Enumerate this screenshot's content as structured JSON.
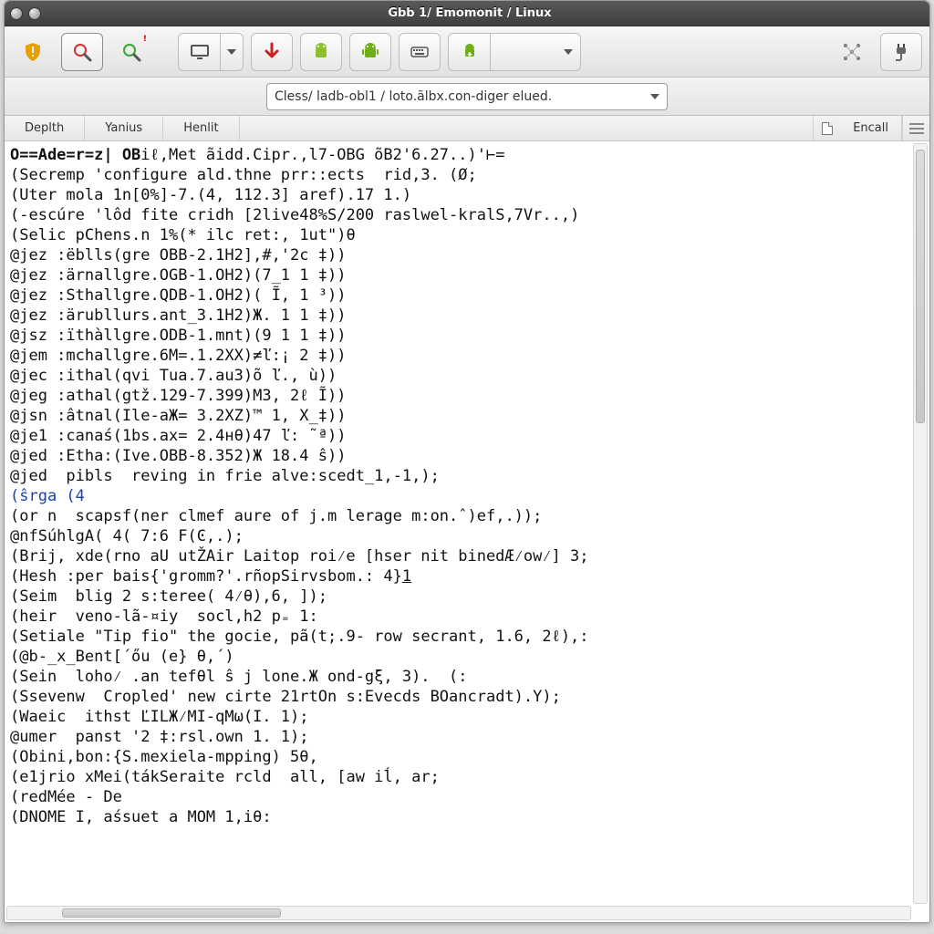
{
  "window": {
    "title": "Gbb 1/ Emomonit / Linux"
  },
  "combo": {
    "selected": "Cless/ ladb-obl1 / loto.ãlbx.con-diger elued."
  },
  "tabs": {
    "items": [
      {
        "label": "Deplth"
      },
      {
        "label": "Yanius"
      },
      {
        "label": "Henlit"
      }
    ],
    "right_label": "Encall"
  },
  "code": {
    "lines": [
      "O==Ade=r=z| OBiℓ,Met ãidd.Cipr.,l7-OBG õB2'6.27..)'⊢=",
      "(Secremp 'configure ald.thne prr::ects  rid,3. (Ø;",
      "(Uter mola 1n[0%]-7.(4, 112.3] aref).17 1.)",
      "(-escúre 'lôd fite cridh [2live48%S/200 raslwel-kralS,7Vr..,)",
      "(Selic pChens.n 1%(* ilc ret:, 1ut\")θ",
      "@jez :ëblls(gre OBB-2.1H2],#,'2c ‡))",
      "@jez :ärnallgre.OGB-1.OH2)(7_1 1 ‡))",
      "@jez :Sthallgre.QDB-1.OH2)( Ĩ, 1 ³))",
      "@jez :ärubllurs.ant_3.1H2)Ж. 1 1 ‡))",
      "@jsz :ïthàllgre.ODB-1.mnt)(9 1 1 ‡))",
      "@jem :mchallgre.6M=.1.2XX)≠ľ:¡ 2 ‡))",
      "@jec :ithal(qvi Tua.7.au3)õ ľ., ù))",
      "@jeg :athal(gtž.129-7.399)M3, 2ℓ Ĩ))",
      "@jsn :âtnal(Ile-aЖ= 3.2XZ)™ 1, X_‡))",
      "@je1 :canaś(1bs.ax= 2.4нθ)47 ľ: ˜ª))",
      "@jed :Etha:(Ive.OBB-8.352)Ж 18.4 ŝ))",
      "@jed  pibls  reving in frie alve:scedt_1,-1,);",
      "(ŝrga (4",
      "(or n  scapsf(ner clmef aure of j.m lerage m:on.ˆ)ef,.));",
      "@nfSúhlgA( 4( 7:6 F(Ͼ,.);",
      "(Brij, xde(rno aU utŽAir Laitop roi⁄e [hser nit binedÆ⁄ow⁄] 3;",
      "(Hesh :per bais{'gromm?'.rñopSirvsbom.: 4}1",
      "(Seim  blig 2 s:teree( 4⁄θ),6, ]);",
      "(heir  veno-lã-¤iy  socl,h2 p₌ 1:",
      "(Setiale \"Tip fio\" the gocie, pã(t;.9- row secrant, 1.6, 2ℓ),:",
      "(@b-_x_Bent[´őu (e} θ,´)",
      "(Sein  loho⁄ .an tefθl ŝ j lone.Ж ond-gξ, 3).  (:",
      "(Ssevenw  Cropled' new cirte 21rtOn s:Evecds BOancradt).Y);",
      "(Waeic  ithst ĽILЖ⁄MI-qMω(I. 1);",
      "@umer  panst '2 ‡:rsl.own 1. 1);",
      "(Obini,bon:{S.mexiela-mpping) 5θ,",
      "(e1jrio xMei(tákSeraite rcld  all, [aw iĺ, ar;",
      "(redMée - De",
      "(DNOME I, aśsuet a MOM 1,iθ:"
    ]
  },
  "icons": {
    "toolbar": [
      "warn-shield-icon",
      "magnifier-icon",
      "magnifier-alert-icon",
      "monitor-icon",
      "dropdown-icon",
      "download-arrow-icon",
      "android-alt-icon",
      "android-icon",
      "keyboard-icon",
      "android-download-icon",
      "dropdown-icon",
      "network-icon",
      "plug-icon"
    ]
  }
}
